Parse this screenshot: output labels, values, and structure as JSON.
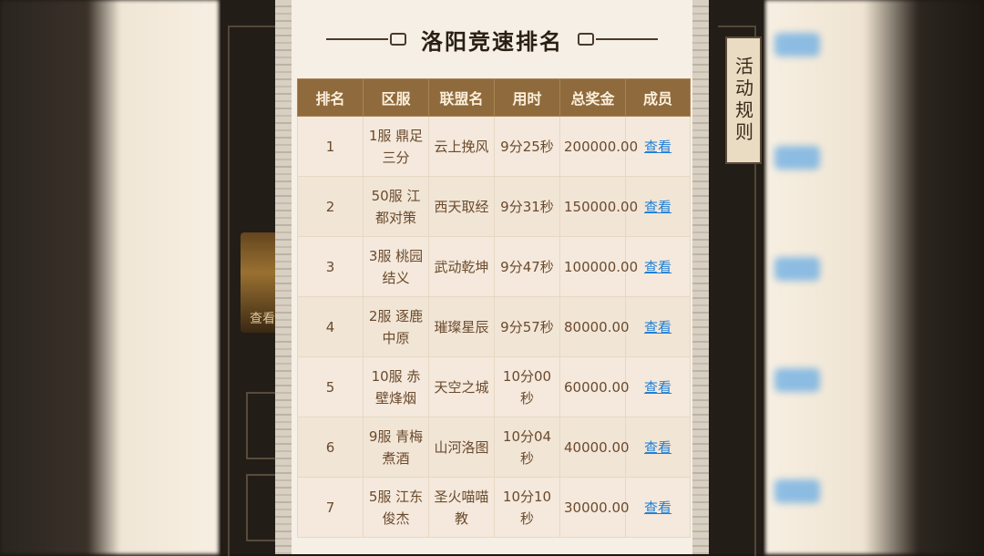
{
  "title": "洛阳竞速排名",
  "rules_tab": "活动规则",
  "side_label": "查看",
  "columns": [
    "排名",
    "区服",
    "联盟名",
    "用时",
    "总奖金",
    "成员"
  ],
  "rows": [
    {
      "rank": "1",
      "server": "1服 鼎足三分",
      "alliance": "云上挽风",
      "time": "9分25秒",
      "bonus": "200000.00",
      "action": "查看"
    },
    {
      "rank": "2",
      "server": "50服 江都对策",
      "alliance": "西天取经",
      "time": "9分31秒",
      "bonus": "150000.00",
      "action": "查看"
    },
    {
      "rank": "3",
      "server": "3服 桃园结义",
      "alliance": "武动乾坤",
      "time": "9分47秒",
      "bonus": "100000.00",
      "action": "查看"
    },
    {
      "rank": "4",
      "server": "2服 逐鹿中原",
      "alliance": "璀璨星辰",
      "time": "9分57秒",
      "bonus": "80000.00",
      "action": "查看"
    },
    {
      "rank": "5",
      "server": "10服 赤壁烽烟",
      "alliance": "天空之城",
      "time": "10分00秒",
      "bonus": "60000.00",
      "action": "查看"
    },
    {
      "rank": "6",
      "server": "9服 青梅煮酒",
      "alliance": "山河洛图",
      "time": "10分04秒",
      "bonus": "40000.00",
      "action": "查看"
    },
    {
      "rank": "7",
      "server": "5服 江东俊杰",
      "alliance": "圣火喵喵教",
      "time": "10分10秒",
      "bonus": "30000.00",
      "action": "查看"
    }
  ],
  "colors": {
    "header_bg": "#8f6a3c",
    "link": "#1f7fd6",
    "panel_bg": "#f6efe5"
  }
}
